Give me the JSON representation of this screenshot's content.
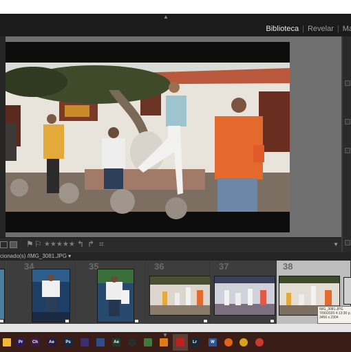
{
  "header": {
    "modules": [
      "Biblioteca",
      "Revelar",
      "Ma"
    ],
    "active_module": "Biblioteca"
  },
  "toolbar": {
    "stars": "★★★★★"
  },
  "filmstrip": {
    "path": "cionado(s) /IMG_3081.JPG",
    "cells": [
      {
        "number": ""
      },
      {
        "number": "34"
      },
      {
        "number": "35"
      },
      {
        "number": "36"
      },
      {
        "number": "37"
      },
      {
        "number": "38"
      }
    ]
  },
  "tooltip": {
    "filename": "IMG_3081.JPG",
    "datetime": "7/06/2020 4:13:30 p.",
    "dimensions": "3456 x 2304"
  },
  "taskbar": {
    "apps": [
      {
        "label": "",
        "icon": "file-explorer-icon",
        "color": "#f2b733"
      },
      {
        "label": "Pr",
        "icon": "premiere-pro-icon",
        "color": "#2a1b5c"
      },
      {
        "label": "Ch",
        "icon": "character-animator-icon",
        "color": "#3c1a4e"
      },
      {
        "label": "Ae",
        "icon": "after-effects-icon",
        "color": "#231b48"
      },
      {
        "label": "Ps",
        "icon": "photoshop-icon",
        "color": "#0f2a44"
      },
      {
        "label": "",
        "icon": "app-icon",
        "color": "#3b2f6e"
      },
      {
        "label": "",
        "icon": "app-icon",
        "color": "#2d4e8a"
      },
      {
        "label": "Ae",
        "icon": "adobe-app-icon",
        "color": "#1d3b2f"
      },
      {
        "label": "",
        "icon": "obs-icon",
        "color": "#2b2b2b"
      },
      {
        "label": "",
        "icon": "app-icon",
        "color": "#3f7a3a"
      },
      {
        "label": "",
        "icon": "vlc-icon",
        "color": "#e07a14"
      },
      {
        "label": "",
        "icon": "acrobat-icon",
        "color": "#c0201c"
      },
      {
        "label": "Lr",
        "icon": "lightroom-icon",
        "color": "#0e2a3c"
      },
      {
        "label": "W",
        "icon": "word-icon",
        "color": "#2b5797"
      },
      {
        "label": "",
        "icon": "firefox-icon",
        "color": "#e0631c"
      },
      {
        "label": "",
        "icon": "chrome-icon",
        "color": "#d8a21a"
      },
      {
        "label": "",
        "icon": "chrome-icon",
        "color": "#c73a2d"
      }
    ]
  },
  "colors": {
    "panel_dark": "#1b1b1b",
    "workspace_gray": "#6f6f6f",
    "filmstrip_bg": "#474747",
    "selected_cell": "#bdbdbd",
    "taskbar_bg": "#3a1d16"
  }
}
